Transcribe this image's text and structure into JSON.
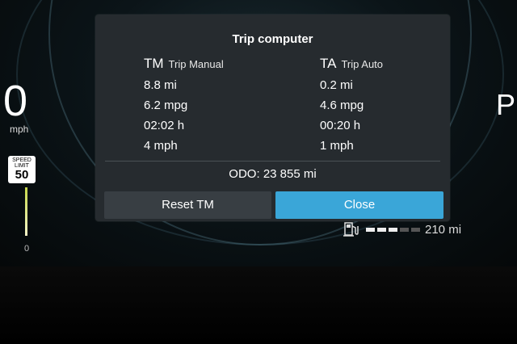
{
  "background": {
    "speed": {
      "value": "0",
      "unit": "mph"
    },
    "speed_limit": {
      "label_line1": "SPEED",
      "label_line2": "LIMIT",
      "value": "50"
    },
    "gauge_min": "0",
    "gear": "P",
    "range": {
      "value": "210 mi",
      "fuel_level_fraction": 0.6
    }
  },
  "dialog": {
    "title": "Trip computer",
    "trip_manual": {
      "abbr": "TM",
      "name": "Trip Manual",
      "distance": "8.8 mi",
      "economy": "6.2 mpg",
      "time": "02:02 h",
      "avg_speed": "4 mph"
    },
    "trip_auto": {
      "abbr": "TA",
      "name": "Trip Auto",
      "distance": "0.2 mi",
      "economy": "4.6 mpg",
      "time": "00:20 h",
      "avg_speed": "1 mph"
    },
    "odo_label": "ODO:",
    "odo_value": "23 855 mi",
    "reset_label": "Reset TM",
    "close_label": "Close"
  },
  "colors": {
    "dialog_bg": "#262b2f",
    "reset_button": "#383e43",
    "close_button": "#3aa6d8"
  },
  "icons": {
    "fuel": "fuel-pump-icon"
  }
}
